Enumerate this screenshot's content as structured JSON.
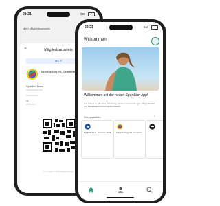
{
  "back_phone": {
    "time": "22:21",
    "signal": "5G",
    "header_label": "Mein Mitgliedsausweis",
    "sheet_title": "Mitgliedsausweis",
    "status_badge": "AKTIV",
    "club_name": "Turnabteilung VfL Gerstetten",
    "card_line_1": "Sportler Team",
    "card_line_2": "Nr.",
    "footer_note": "Gerstetten in Ihrer Mitgliedschaft"
  },
  "front_phone": {
    "time": "22:21",
    "signal": "5G",
    "header_title": "Willkommen",
    "hero_title": "Willkommen bei der neuen SportLion App!",
    "hero_body": "Hier findest du alle Infos zu Training, Spielen, Veranstaltungen, Mitgliedschaft und Neuigkeiten rund um deinen Verein.",
    "section_title": "Bitte auswählen",
    "tiles": [
      {
        "label": "TC 1896 Post, Schwarz-Weiß"
      },
      {
        "label": "Turnabteilung VfL Gerstetten"
      },
      {
        "label": ""
      }
    ],
    "nav": [
      {
        "icon": "home-icon"
      },
      {
        "icon": "person-icon"
      },
      {
        "icon": "search-icon"
      }
    ]
  },
  "colors": {
    "accent": "#2f9e76",
    "hero_sky": "#a9d3ee",
    "frame": "#1f1f1f"
  }
}
